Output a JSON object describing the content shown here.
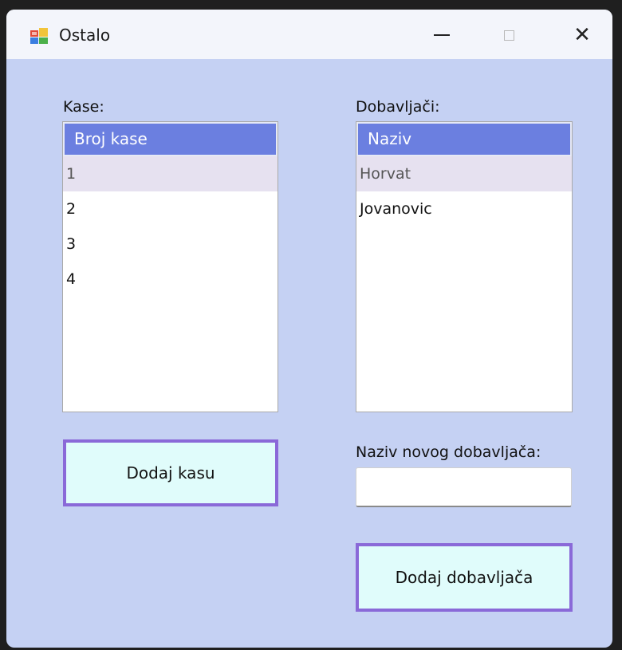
{
  "window": {
    "title": "Ostalo",
    "icon": "winforms-app-icon",
    "controls": {
      "minimize": "minimize-icon",
      "maximize": "maximize-icon",
      "close": "close-icon",
      "close_glyph": "✕"
    }
  },
  "kase": {
    "label": "Kase:",
    "header": "Broj kase",
    "items": [
      "1",
      "2",
      "3",
      "4"
    ],
    "selected_index": 0
  },
  "dobavljaci": {
    "label": "Dobavljači:",
    "header": "Naziv",
    "items": [
      "Horvat",
      "Jovanovic"
    ],
    "selected_index": 0
  },
  "new_supplier": {
    "label": "Naziv novog dobavljača:",
    "value": "",
    "placeholder": ""
  },
  "buttons": {
    "add_register": "Dodaj kasu",
    "add_supplier": "Dodaj dobavljača"
  },
  "colors": {
    "form_background": "#c5d1f3",
    "header_background": "#6b7fe0",
    "selected_row": "#e6e1f0",
    "button_background": "#e0fcfb",
    "button_border": "#8a69d8"
  }
}
